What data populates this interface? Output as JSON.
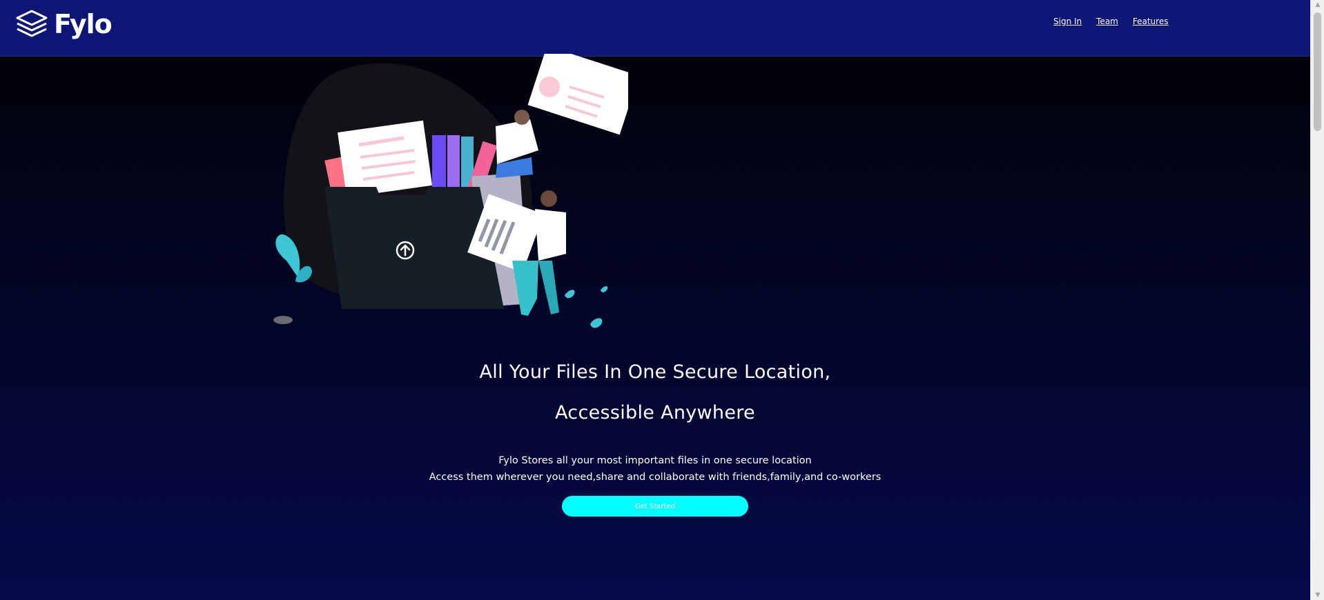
{
  "brand": {
    "name": "Fylo",
    "logo_icon": "stacked-layers-icon"
  },
  "nav": {
    "links": [
      "Sign In",
      "Team",
      "Features"
    ]
  },
  "hero": {
    "illustration": "person-uploading-files-to-folder-illustration",
    "upload_icon": "arrow-up-circle-icon",
    "title_line1": "All Your Files In One Secure Location,",
    "title_line2": "Accessible Anywhere",
    "desc_line1": "Fylo Stores all your most important files in one secure location",
    "desc_line2": "Access them wherever you need,share and collaborate with friends,family,and co-workers",
    "cta_label": "Get Started"
  },
  "scrollbar": {
    "up_icon": "triangle-up-icon",
    "down_icon": "triangle-down-icon"
  },
  "colors": {
    "navbar": "#0c1775",
    "accent": "#00ffff",
    "background_top": "#010103",
    "background_bottom": "#050a4a"
  }
}
